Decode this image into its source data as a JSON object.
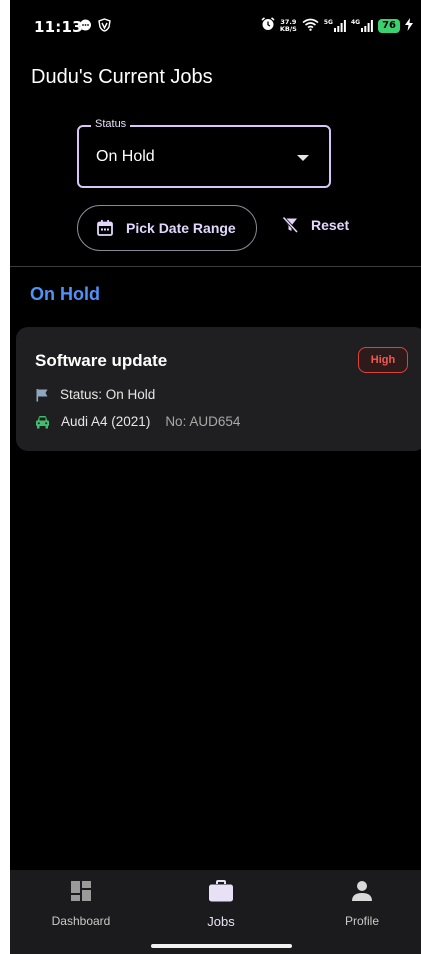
{
  "status_bar": {
    "time": "11:13",
    "net_speed_value": "37.9",
    "net_speed_unit": "KB/S",
    "signal_1_label": "5G",
    "signal_2_label": "4G",
    "battery": "76"
  },
  "page": {
    "title": "Dudu's Current Jobs"
  },
  "filters": {
    "status_label": "Status",
    "status_value": "On Hold",
    "pick_date_label": "Pick Date Range",
    "reset_label": "Reset"
  },
  "group": {
    "heading": "On Hold"
  },
  "jobs": [
    {
      "title": "Software update",
      "priority": "High",
      "status_text": "Status: On Hold",
      "vehicle": "Audi A4 (2021)",
      "plate": "No: AUD654"
    }
  ],
  "nav": {
    "items": [
      {
        "label": "Dashboard",
        "icon": "dashboard-icon"
      },
      {
        "label": "Jobs",
        "icon": "briefcase-icon",
        "active": true
      },
      {
        "label": "Profile",
        "icon": "person-icon"
      }
    ]
  },
  "colors": {
    "accent": "#4f93f6",
    "outline": "#d7c6f7",
    "priority_high": "#e0413a",
    "vehicle_icon": "#3fbf6b"
  }
}
